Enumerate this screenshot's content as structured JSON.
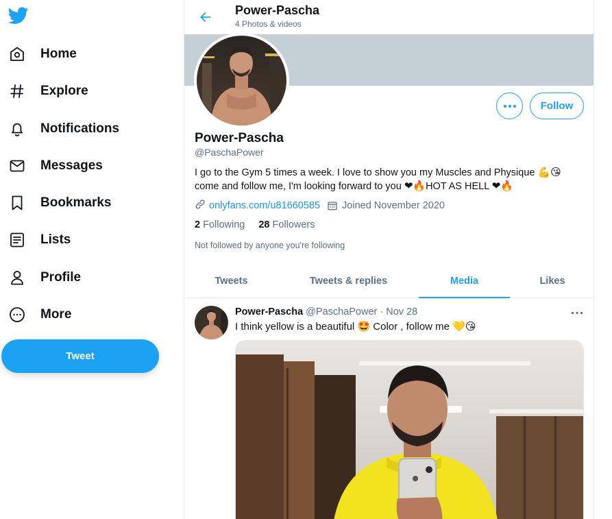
{
  "nav": {
    "items": [
      {
        "label": "Home",
        "icon": "home-icon"
      },
      {
        "label": "Explore",
        "icon": "hashtag-icon"
      },
      {
        "label": "Notifications",
        "icon": "bell-icon"
      },
      {
        "label": "Messages",
        "icon": "envelope-icon"
      },
      {
        "label": "Bookmarks",
        "icon": "bookmark-icon"
      },
      {
        "label": "Lists",
        "icon": "list-icon"
      },
      {
        "label": "Profile",
        "icon": "person-icon"
      },
      {
        "label": "More",
        "icon": "more-circle-icon"
      }
    ],
    "tweet_button": "Tweet"
  },
  "header": {
    "title": "Power-Pascha",
    "subtitle": "4 Photos & videos"
  },
  "profile": {
    "name": "Power-Pascha",
    "handle": "@PaschaPower",
    "bio_line1": "I go to the Gym 5 times a week. I love to show you my Muscles and Physique",
    "bio_line1_emoji": "💪😘",
    "bio_line2_a": "come and follow me, I'm looking forward to you",
    "bio_line2_emoji_a": "❤🔥",
    "bio_line2_b": "HOT AS  HELL",
    "bio_line2_emoji_b": "❤🔥",
    "link": "onlyfans.com/u81660585",
    "joined": "Joined November 2020",
    "following_count": "2",
    "following_label": "Following",
    "followers_count": "28",
    "followers_label": "Followers",
    "not_followed": "Not followed by anyone you're following",
    "follow_label": "Follow"
  },
  "tabs": [
    {
      "label": "Tweets",
      "active": false
    },
    {
      "label": "Tweets & replies",
      "active": false
    },
    {
      "label": "Media",
      "active": true
    },
    {
      "label": "Likes",
      "active": false
    }
  ],
  "tweet": {
    "name": "Power-Pascha",
    "handle": "@PaschaPower",
    "dot": "·",
    "date": "Nov 28",
    "text_a": "I think yellow is a beautiful",
    "emoji_a": "🤩",
    "text_b": "Color , follow me",
    "emoji_b": "💛😘"
  },
  "colors": {
    "accent": "#1da1f2",
    "banner": "#c4cfd6",
    "muted": "#5b7083"
  }
}
